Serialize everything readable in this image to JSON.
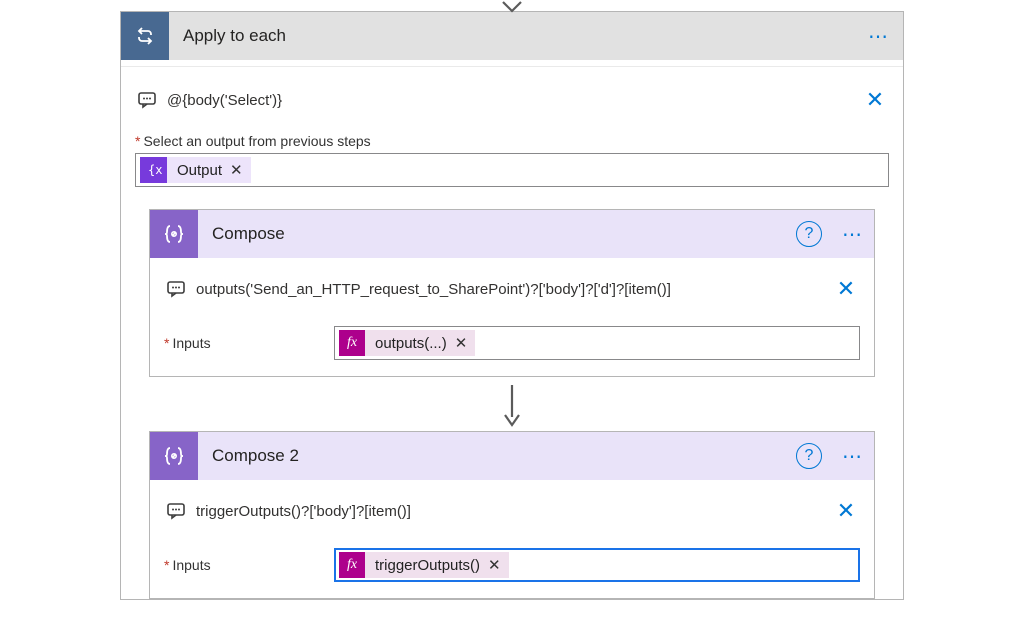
{
  "connector_arrow": "▼",
  "outer": {
    "title": "Apply to each",
    "comment": "@{body('Select')}",
    "field_label": "Select an output from previous steps",
    "token_label": "Output"
  },
  "compose1": {
    "title": "Compose",
    "comment": "outputs('Send_an_HTTP_request_to_SharePoint')?['body']?['d']?[item()]",
    "inputs_label": "Inputs",
    "token_label": "outputs(...)"
  },
  "compose2": {
    "title": "Compose 2",
    "comment": "triggerOutputs()?['body']?[item()]",
    "inputs_label": "Inputs",
    "token_label": "triggerOutputs()"
  },
  "icons": {
    "fx": "fx",
    "var": "{x}",
    "help": "?",
    "close": "✕",
    "remove": "✕",
    "menu": "⋯"
  }
}
